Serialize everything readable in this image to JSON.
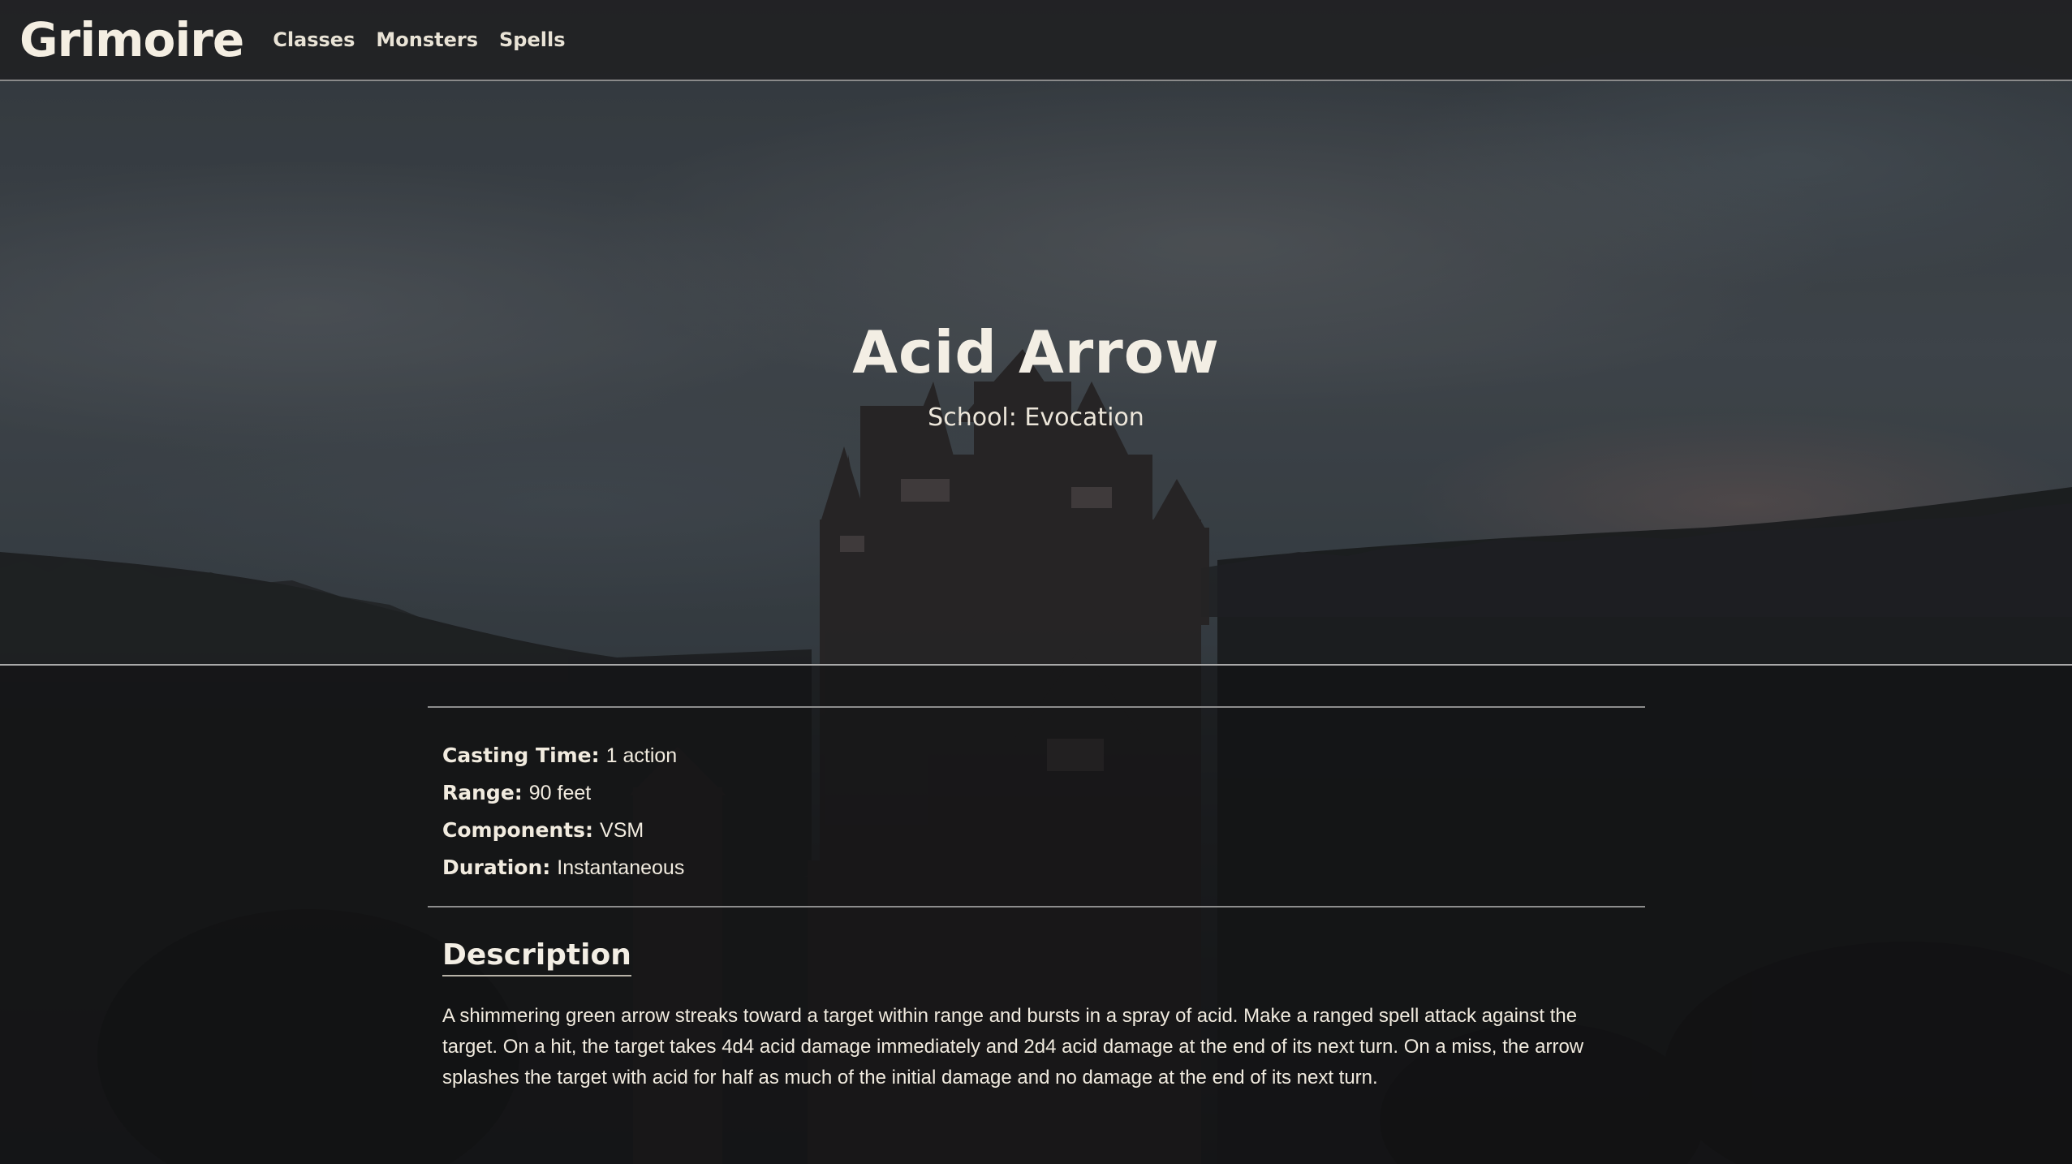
{
  "nav": {
    "brand": "Grimoire",
    "links": [
      "Classes",
      "Monsters",
      "Spells"
    ]
  },
  "spell": {
    "title": "Acid Arrow",
    "school": "School: Evocation",
    "stats": [
      {
        "label": "Casting Time:",
        "value": "1 action"
      },
      {
        "label": "Range:",
        "value": "90 feet"
      },
      {
        "label": "Components:",
        "value": "VSM"
      },
      {
        "label": "Duration:",
        "value": "Instantaneous"
      }
    ],
    "description_heading": "Description",
    "description": "A shimmering green arrow streaks toward a target within range and bursts in a spray of acid. Make a ranged spell attack against the target. On a hit, the target takes 4d4 acid damage immediately and 2d4 acid damage at the end of its next turn. On a miss, the arrow splashes the target with acid for half as much of the initial damage and no damage at the end of its next turn."
  }
}
